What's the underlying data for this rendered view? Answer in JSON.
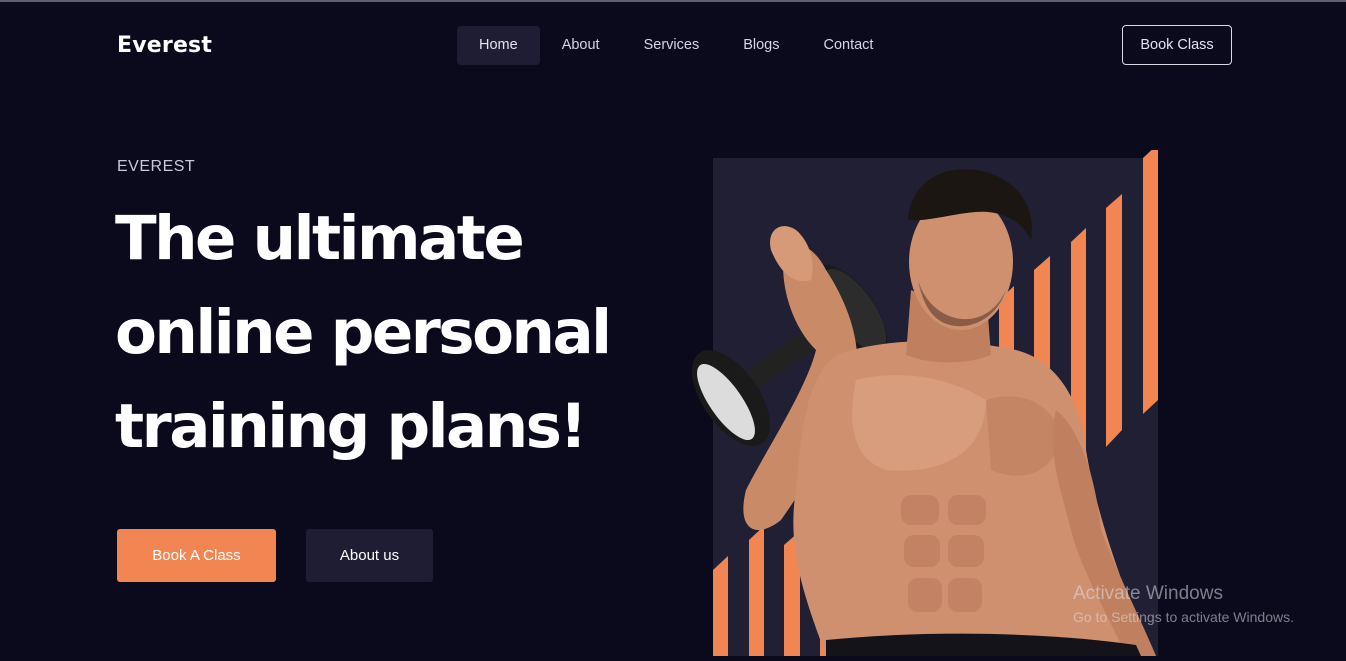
{
  "brand": {
    "logo": "Everest"
  },
  "nav": {
    "items": [
      {
        "label": "Home",
        "active": true
      },
      {
        "label": "About"
      },
      {
        "label": "Services"
      },
      {
        "label": "Blogs"
      },
      {
        "label": "Contact"
      }
    ],
    "cta_label": "Book Class"
  },
  "hero": {
    "eyebrow": "EVEREST",
    "headline_lines": [
      "The ultimate",
      "online personal",
      "training plans!"
    ],
    "primary_button": "Book A Class",
    "secondary_button": "About us",
    "image_icon": "fitness-man-dumbbell-icon"
  },
  "watermark": {
    "line1": "Activate Windows",
    "line2": "Go to Settings to activate Windows."
  },
  "colors": {
    "background": "#0b0a1c",
    "accent": "#f28653",
    "panel": "#211f33",
    "secondary_button": "#1f1d33"
  }
}
